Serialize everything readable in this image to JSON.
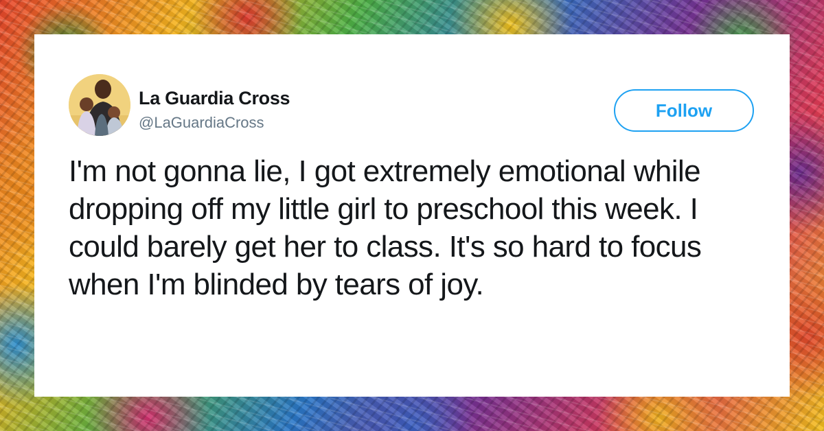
{
  "tweet": {
    "author": {
      "display_name": "La Guardia Cross",
      "handle": "@LaGuardiaCross",
      "avatar_icon": "profile-photo"
    },
    "follow_button": {
      "label": "Follow",
      "color": "#1da1f2"
    },
    "text": "I'm not gonna lie, I got extremely emotional while dropping off my little girl to preschool this week. I could barely get her to class. It's so hard to focus when I'm blinded by tears of joy."
  },
  "colors": {
    "text_primary": "#14171a",
    "text_secondary": "#657786",
    "card_background": "#ffffff"
  }
}
